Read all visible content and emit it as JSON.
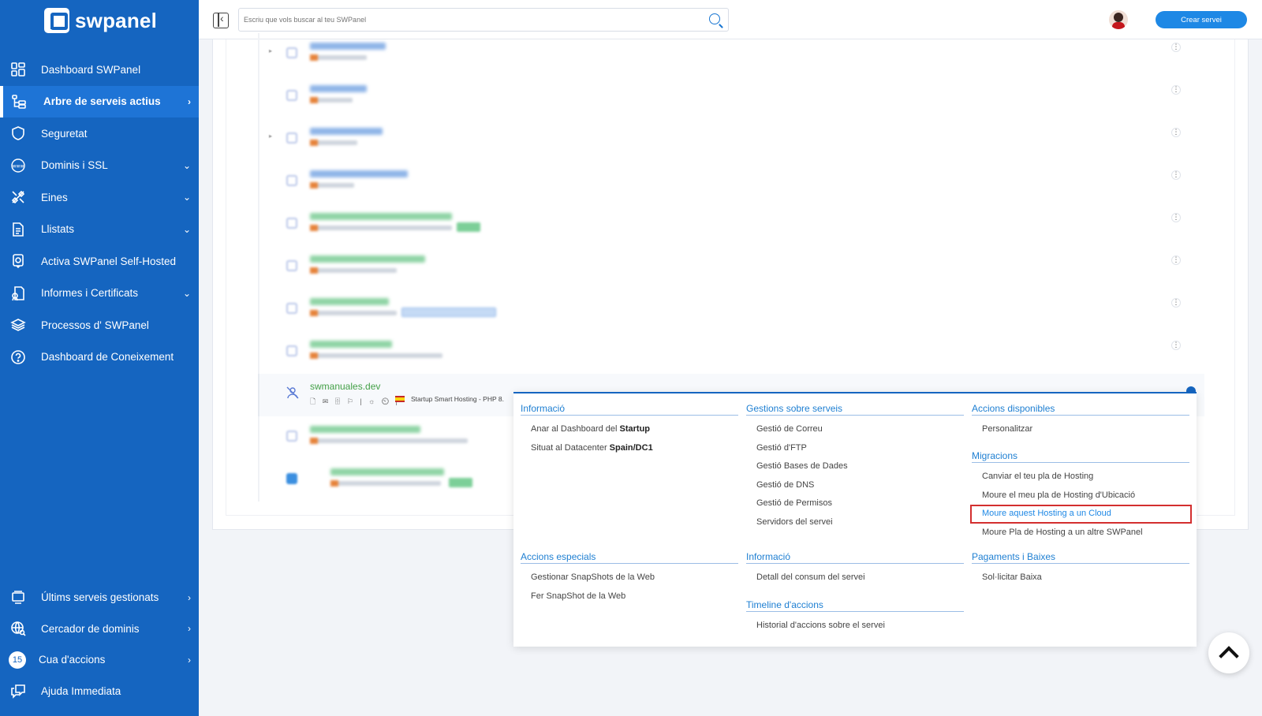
{
  "brand": {
    "name": "swpanel"
  },
  "sidebar": {
    "items": [
      {
        "label": "Dashboard SWPanel",
        "icon": "grid-icon",
        "chevron": ""
      },
      {
        "label": "Arbre de serveis actius",
        "icon": "tree-icon",
        "chevron": "›",
        "active": true
      },
      {
        "label": "Seguretat",
        "icon": "shield-icon",
        "chevron": ""
      },
      {
        "label": "Dominis i SSL",
        "icon": "www-globe-icon",
        "chevron": "⌄"
      },
      {
        "label": "Eines",
        "icon": "tools-icon",
        "chevron": "⌄"
      },
      {
        "label": "Llistats",
        "icon": "document-icon",
        "chevron": "⌄"
      },
      {
        "label": "Activa SWPanel Self-Hosted",
        "icon": "badge-icon",
        "chevron": ""
      },
      {
        "label": "Informes i Certificats",
        "icon": "report-icon",
        "chevron": "⌄"
      },
      {
        "label": "Processos d' SWPanel",
        "icon": "layers-icon",
        "chevron": ""
      },
      {
        "label": "Dashboard de Coneixement",
        "icon": "help-circle-icon",
        "chevron": ""
      }
    ],
    "bottom_items": [
      {
        "label": "Últims serveis gestionats",
        "icon": "monitor-icon",
        "chevron": "›"
      },
      {
        "label": "Cercador de dominis",
        "icon": "globe-search-icon",
        "chevron": "›"
      },
      {
        "label": "Cua d'accions",
        "badge": "15",
        "chevron": "›"
      },
      {
        "label": "Ajuda Immediata",
        "icon": "chat-icon",
        "chevron": ""
      }
    ]
  },
  "topbar": {
    "search_placeholder": "Escriu que vols buscar al teu SWPanel",
    "create_label": "Crear servei"
  },
  "service_row": {
    "name": "swmanuales.dev",
    "info": "Startup Smart Hosting - PHP 8.",
    "icons": "🗋 ✉ 🗄 ⚐ | ☼ ⏲ |"
  },
  "menu": {
    "sections": [
      {
        "title": "Informació",
        "items": [
          {
            "text": "Anar al Dashboard del ",
            "bold": "Startup"
          },
          {
            "text": "Situat al Datacenter ",
            "bold": "Spain/DC1"
          }
        ]
      },
      {
        "title": "Gestions sobre serveis",
        "items": [
          {
            "text": "Gestió de Correu"
          },
          {
            "text": "Gestió d'FTP"
          },
          {
            "text": "Gestió Bases de Dades"
          },
          {
            "text": "Gestió de DNS"
          },
          {
            "text": "Gestió de Permisos"
          },
          {
            "text": "Servidors del servei"
          }
        ]
      },
      {
        "title": "Accions disponibles",
        "items": [
          {
            "text": "Personalitzar"
          }
        ]
      },
      {
        "title": "Migracions",
        "items": [
          {
            "text": "Canviar el teu pla de Hosting"
          },
          {
            "text": "Moure el meu pla de Hosting d'Ubicació"
          },
          {
            "text": "Moure aquest Hosting a un Cloud",
            "highlight": true
          },
          {
            "text": "Moure Pla de Hosting a un altre SWPanel"
          }
        ]
      },
      {
        "title": "Accions especials",
        "items": [
          {
            "text": "Gestionar SnapShots de la Web"
          },
          {
            "text": "Fer SnapShot de la Web"
          }
        ]
      },
      {
        "title": "Informació",
        "items": [
          {
            "text": "Detall del consum del servei"
          }
        ]
      },
      {
        "title": "Timeline d'accions",
        "items": [
          {
            "text": "Historial d'accions sobre el servei"
          }
        ]
      },
      {
        "title": "Pagaments i Baixes",
        "items": [
          {
            "text": "Sol·licitar Baixa"
          }
        ]
      }
    ]
  },
  "colors": {
    "sidebar": "#1565c0",
    "accent": "#1e88e5",
    "highlight_border": "#d32f2f",
    "domain_green": "#43a047"
  }
}
